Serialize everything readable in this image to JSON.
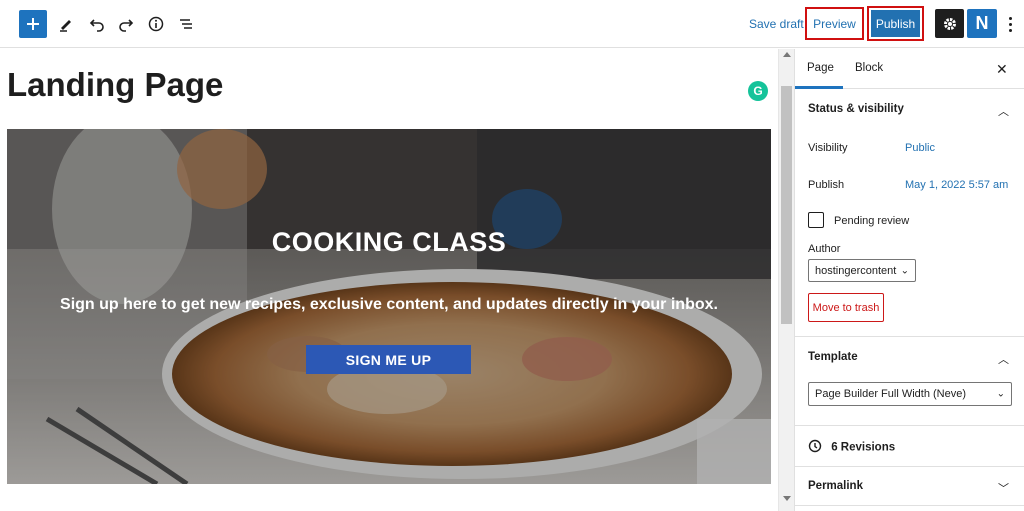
{
  "toolbar": {
    "save_draft": "Save draft",
    "preview": "Preview",
    "publish": "Publish",
    "neve_logo": "N",
    "icons": [
      "plus-icon",
      "pencil-icon",
      "undo-icon",
      "redo-icon",
      "info-icon",
      "list-view-icon",
      "gear-icon",
      "neve-icon",
      "more-vertical-icon"
    ]
  },
  "editor": {
    "title": "Landing Page",
    "grammarly": "G",
    "hero": {
      "heading": "COOKING CLASS",
      "subtext": "Sign up here to get new recipes, exclusive content, and updates directly in your inbox.",
      "button": "SIGN ME UP"
    }
  },
  "sidebar": {
    "tabs": [
      "Page",
      "Block"
    ],
    "status": {
      "heading": "Status & visibility",
      "visibility_label": "Visibility",
      "visibility_value": "Public",
      "publish_label": "Publish",
      "publish_value": "May 1, 2022 5:57 am",
      "pending": "Pending review",
      "author_label": "Author",
      "author_value": "hostingercontent",
      "trash": "Move to trash"
    },
    "template": {
      "heading": "Template",
      "value": "Page Builder Full Width (Neve)"
    },
    "revisions": "6 Revisions",
    "permalink": "Permalink"
  },
  "colors": {
    "accent": "#1e73be",
    "link": "#2271b1",
    "highlight_border": "#d01010",
    "hero_button": "#2c58b5",
    "danger": "#cc1818"
  }
}
